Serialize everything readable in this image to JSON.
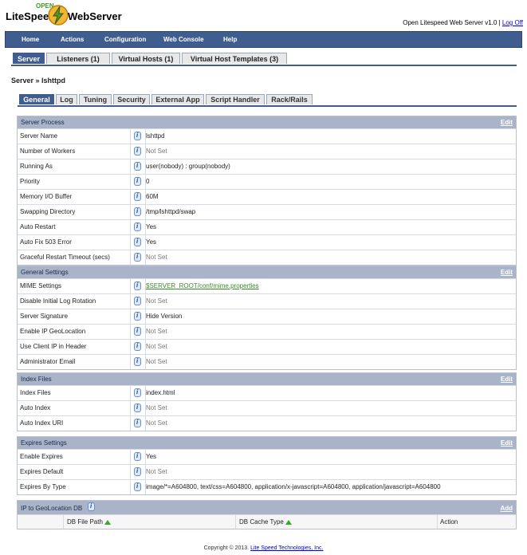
{
  "logo": {
    "open": "OPEN",
    "lite": "LiteSpeed",
    "web": "WebServer"
  },
  "header": {
    "product": "Open Litespeed Web Server v1.0",
    "sep": " | ",
    "logoff": "Log Off"
  },
  "nav": [
    "Home",
    "Actions",
    "Configuration",
    "Web Console",
    "Help"
  ],
  "tabs": [
    "Server",
    "Listeners (1)",
    "Virtual Hosts (1)",
    "Virtual Host Templates (3)"
  ],
  "breadcrumb": "Server » lshttpd",
  "subtabs": [
    "General",
    "Log",
    "Tuning",
    "Security",
    "External App",
    "Script Handler",
    "Rack/Rails"
  ],
  "edit_label": "Edit",
  "add_label": "Add",
  "sections": {
    "server_process": {
      "title": "Server Process",
      "rows": [
        {
          "label": "Server Name",
          "value": "lshttpd"
        },
        {
          "label": "Number of Workers",
          "value": "Not Set"
        },
        {
          "label": "Running As",
          "value": "user(nobody) : group(nobody)"
        },
        {
          "label": "Priority",
          "value": "0"
        },
        {
          "label": "Memory I/O Buffer",
          "value": "60M"
        },
        {
          "label": "Swapping Directory",
          "value": "/tmp/lshttpd/swap"
        },
        {
          "label": "Auto Restart",
          "value": "Yes"
        },
        {
          "label": "Auto Fix 503 Error",
          "value": "Yes"
        },
        {
          "label": "Graceful Restart Timeout (secs)",
          "value": "Not Set"
        }
      ]
    },
    "general_settings": {
      "title": "General Settings",
      "rows": [
        {
          "label": "MIME Settings",
          "value": "$SERVER_ROOT/conf/mime.properties"
        },
        {
          "label": "Disable Initial Log Rotation",
          "value": "Not Set"
        },
        {
          "label": "Server Signature",
          "value": "Hide Version"
        },
        {
          "label": "Enable IP GeoLocation",
          "value": "Not Set"
        },
        {
          "label": "Use Client IP in Header",
          "value": "Not Set"
        },
        {
          "label": "Administrator Email",
          "value": "Not Set"
        }
      ]
    },
    "index_files": {
      "title": "Index Files",
      "rows": [
        {
          "label": "Index Files",
          "value": "index.html"
        },
        {
          "label": "Auto Index",
          "value": "Not Set"
        },
        {
          "label": "Auto Index URI",
          "value": "Not Set"
        }
      ]
    },
    "expires": {
      "title": "Expires Settings",
      "rows": [
        {
          "label": "Enable Expires",
          "value": "Yes"
        },
        {
          "label": "Expires Default",
          "value": "Not Set"
        },
        {
          "label": "Expires By Type",
          "value": "image/*=A604800, text/css=A604800, application/x-javascript=A604800, application/javascript=A604800"
        }
      ]
    },
    "geodb": {
      "title": "IP to GeoLocation DB",
      "columns": [
        "DB File Path",
        "DB Cache Type",
        "Action"
      ]
    }
  },
  "footer": {
    "copyright": "Copyright © 2013.",
    "company": "Lite Speed Technologies, Inc."
  }
}
